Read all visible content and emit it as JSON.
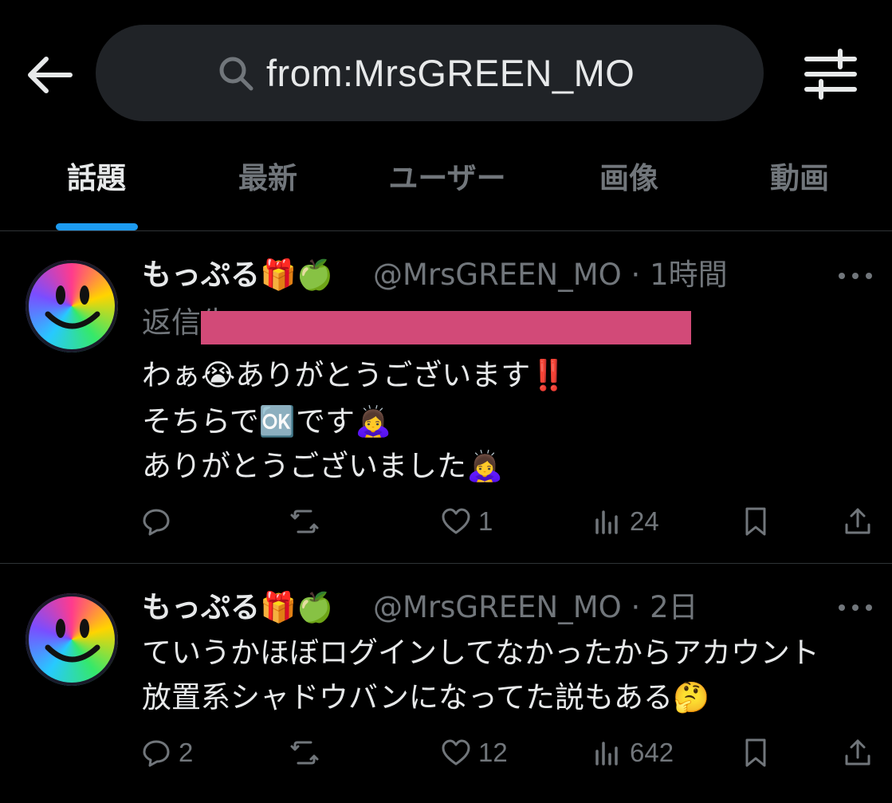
{
  "header": {
    "back_icon": "arrow-left-icon",
    "search_query": "from:MrsGREEN_MO",
    "search_icon": "search-icon",
    "filter_icon": "sliders-icon"
  },
  "tabs": [
    {
      "label": "話題",
      "active": true
    },
    {
      "label": "最新",
      "active": false
    },
    {
      "label": "ユーザー",
      "active": false
    },
    {
      "label": "画像",
      "active": false
    },
    {
      "label": "動画",
      "active": false
    }
  ],
  "posts": [
    {
      "display_name": "もっぷる🎁🍏",
      "handle": "@MrsGREEN_MO",
      "time": "1時間",
      "reply_label": "返信先",
      "text_lines": [
        "わぁ😭ありがとうございます‼️",
        "そちらで🆗です🙇‍♀️",
        "ありがとうございました🙇‍♀️"
      ],
      "stats": {
        "replies": "",
        "reposts": "",
        "likes": "1",
        "views": "24"
      }
    },
    {
      "display_name": "もっぷる🎁🍏",
      "handle": "@MrsGREEN_MO",
      "time": "2日",
      "text_lines": [
        "ていうかほぼログインしてなかったからアカウント",
        "放置系シャドウバンになってた説もある🤔"
      ],
      "stats": {
        "replies": "2",
        "reposts": "",
        "likes": "12",
        "views": "642"
      }
    }
  ],
  "colors": {
    "background": "#000000",
    "accent": "#1d9bf0",
    "muted": "#71767b",
    "text": "#e7e9ea",
    "redaction": "#d24a78"
  }
}
